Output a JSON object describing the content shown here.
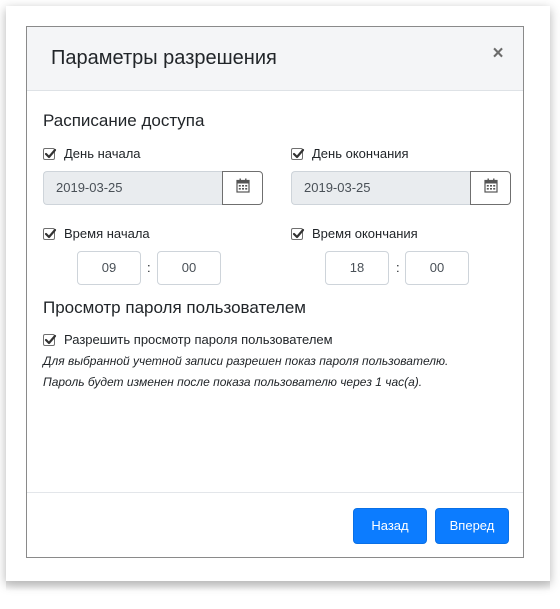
{
  "modal": {
    "title": "Параметры разрешения",
    "close_symbol": "×"
  },
  "schedule": {
    "title": "Расписание доступа",
    "start_day": {
      "label": "День начала",
      "checked": true,
      "value": "2019-03-25",
      "icon": "calendar-icon"
    },
    "end_day": {
      "label": "День окончания",
      "checked": true,
      "value": "2019-03-25",
      "icon": "calendar-icon"
    },
    "start_time": {
      "label": "Время начала",
      "checked": true,
      "hours": "09",
      "separator": ":",
      "minutes": "00"
    },
    "end_time": {
      "label": "Время окончания",
      "checked": true,
      "hours": "18",
      "separator": ":",
      "minutes": "00"
    }
  },
  "password_view": {
    "title": "Просмотр пароля пользователем",
    "allow_label": "Разрешить просмотр пароля пользователем",
    "allow_checked": true,
    "hint_line1": "Для выбранной учетной записи разрешен показ пароля пользователю.",
    "hint_line2": "Пароль будет изменен после показа пользователю через 1 час(а)."
  },
  "footer": {
    "back_label": "Назад",
    "next_label": "Вперед",
    "accent_color": "#0c7cff"
  }
}
